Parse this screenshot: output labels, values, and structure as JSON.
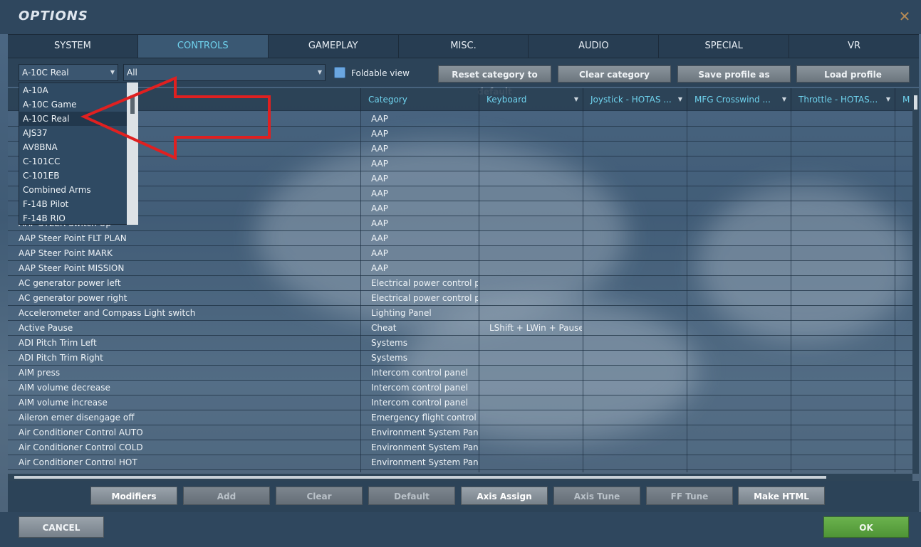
{
  "window": {
    "title": "OPTIONS",
    "close_icon": "close-icon"
  },
  "tabs": [
    {
      "label": "SYSTEM",
      "active": false
    },
    {
      "label": "CONTROLS",
      "active": true
    },
    {
      "label": "GAMEPLAY",
      "active": false
    },
    {
      "label": "MISC.",
      "active": false
    },
    {
      "label": "AUDIO",
      "active": false
    },
    {
      "label": "SPECIAL",
      "active": false
    },
    {
      "label": "VR",
      "active": false
    }
  ],
  "toolbar": {
    "aircraft_select": "A-10C Real",
    "category_select": "All",
    "foldable_view_label": "Foldable view",
    "reset_category_label": "Reset category to default",
    "clear_category_label": "Clear category",
    "save_profile_label": "Save profile as",
    "load_profile_label": "Load profile"
  },
  "dropdown": {
    "items": [
      "A-10A",
      "A-10C Game",
      "A-10C Real",
      "AJS37",
      "AV8BNA",
      "C-101CC",
      "C-101EB",
      "Combined Arms",
      "F-14B Pilot",
      "F-14B RIO"
    ],
    "selected": "A-10C Real"
  },
  "table": {
    "headers": {
      "category": "Category",
      "keyboard": "Keyboard",
      "joystick": "Joystick - HOTAS ...",
      "mfg": "MFG Crosswind ...",
      "throttle": "Throttle - HOTAS...",
      "more": "M"
    },
    "rows": [
      {
        "action": "",
        "category": "AAP",
        "keyboard": ""
      },
      {
        "action": "",
        "category": "AAP",
        "keyboard": ""
      },
      {
        "action": "",
        "category": "AAP",
        "keyboard": ""
      },
      {
        "action": "",
        "category": "AAP",
        "keyboard": ""
      },
      {
        "action": "",
        "category": "AAP",
        "keyboard": ""
      },
      {
        "action": "",
        "category": "AAP",
        "keyboard": ""
      },
      {
        "action": "",
        "category": "AAP",
        "keyboard": ""
      },
      {
        "action": "AAP STEER Switch Up",
        "category": "AAP",
        "keyboard": ""
      },
      {
        "action": "AAP Steer Point FLT PLAN",
        "category": "AAP",
        "keyboard": ""
      },
      {
        "action": "AAP Steer Point MARK",
        "category": "AAP",
        "keyboard": ""
      },
      {
        "action": "AAP Steer Point MISSION",
        "category": "AAP",
        "keyboard": ""
      },
      {
        "action": "AC generator power left",
        "category": "Electrical power control pa",
        "keyboard": ""
      },
      {
        "action": "AC generator power right",
        "category": "Electrical power control pa",
        "keyboard": ""
      },
      {
        "action": "Accelerometer and Compass Light switch",
        "category": "Lighting Panel",
        "keyboard": ""
      },
      {
        "action": "Active Pause",
        "category": "Cheat",
        "keyboard": "LShift + LWin + Pause"
      },
      {
        "action": "ADI Pitch Trim Left",
        "category": "Systems",
        "keyboard": ""
      },
      {
        "action": "ADI Pitch Trim Right",
        "category": "Systems",
        "keyboard": ""
      },
      {
        "action": "AIM press",
        "category": "Intercom control panel",
        "keyboard": ""
      },
      {
        "action": "AIM volume decrease",
        "category": "Intercom control panel",
        "keyboard": ""
      },
      {
        "action": "AIM volume increase",
        "category": "Intercom control panel",
        "keyboard": ""
      },
      {
        "action": "Aileron emer disengage off",
        "category": "Emergency flight control p",
        "keyboard": ""
      },
      {
        "action": "Air Conditioner Control AUTO",
        "category": "Environment System Pane",
        "keyboard": ""
      },
      {
        "action": "Air Conditioner Control COLD",
        "category": "Environment System Pane",
        "keyboard": ""
      },
      {
        "action": "Air Conditioner Control HOT",
        "category": "Environment System Pane",
        "keyboard": ""
      }
    ]
  },
  "bottom_buttons": [
    {
      "label": "Modifiers",
      "enabled": true
    },
    {
      "label": "Add",
      "enabled": false
    },
    {
      "label": "Clear",
      "enabled": false
    },
    {
      "label": "Default",
      "enabled": false
    },
    {
      "label": "Axis Assign",
      "enabled": true
    },
    {
      "label": "Axis Tune",
      "enabled": false
    },
    {
      "label": "FF Tune",
      "enabled": false
    },
    {
      "label": "Make HTML",
      "enabled": true
    }
  ],
  "footer": {
    "cancel_label": "CANCEL",
    "ok_label": "OK"
  },
  "colors": {
    "accent": "#6fd3ee",
    "ok_green": "#5aa33f",
    "annotation_red": "#e02020",
    "close_orange": "#b58a55"
  }
}
